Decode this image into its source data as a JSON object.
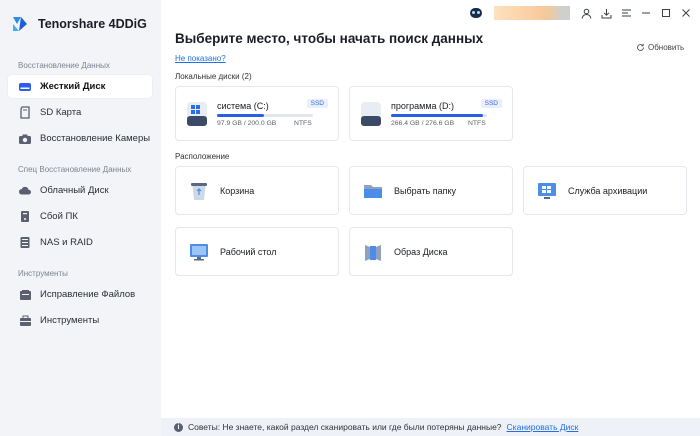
{
  "app": {
    "title": "Tenorshare 4DDiG"
  },
  "sidebar": {
    "sections": [
      {
        "title": "Восстановление Данных"
      },
      {
        "title": "Спец Восстановление Данных"
      },
      {
        "title": "Инструменты"
      }
    ],
    "items": [
      {
        "label": "Жесткий Диск",
        "icon": "hdd-icon",
        "active": true
      },
      {
        "label": "SD Карта",
        "icon": "sd-card-icon"
      },
      {
        "label": "Восстановление Камеры",
        "icon": "camera-icon"
      },
      {
        "label": "Облачный Диск",
        "icon": "cloud-icon"
      },
      {
        "label": "Сбой ПК",
        "icon": "pc-crash-icon"
      },
      {
        "label": "NAS и RAID",
        "icon": "nas-icon"
      },
      {
        "label": "Исправление Файлов",
        "icon": "file-repair-icon"
      },
      {
        "label": "Инструменты",
        "icon": "toolbox-icon"
      }
    ]
  },
  "main": {
    "title": "Выберите место, чтобы начать поиск данных",
    "not_shown_link": "Не показано?",
    "refresh_label": "Обновить",
    "local_disks_label": "Локальные диски (2)",
    "drives": [
      {
        "name": "система (C:)",
        "badge": "SSD",
        "size": "97.9 GB / 200.0 GB",
        "fs": "NTFS",
        "usage": 0.49
      },
      {
        "name": "программа (D:)",
        "badge": "SSD",
        "size": "266.4 GB / 276.6 GB",
        "fs": "NTFS",
        "usage": 0.96
      }
    ],
    "location_label": "Расположение",
    "locations": [
      {
        "label": "Корзина",
        "icon": "recycle-bin-icon"
      },
      {
        "label": "Выбрать папку",
        "icon": "folder-icon"
      },
      {
        "label": "Служба архивации",
        "icon": "backup-service-icon"
      },
      {
        "label": "Рабочий стол",
        "icon": "desktop-icon"
      },
      {
        "label": "Образ Диска",
        "icon": "disk-image-icon"
      }
    ]
  },
  "footer": {
    "tip": "Советы: Не знаете, какой раздел сканировать или где были потеряны данные?",
    "link": "Сканировать Диск"
  },
  "colors": {
    "accent": "#2a5ee8",
    "sidebar_bg": "#f2f4f8",
    "link": "#1f6fe5"
  }
}
